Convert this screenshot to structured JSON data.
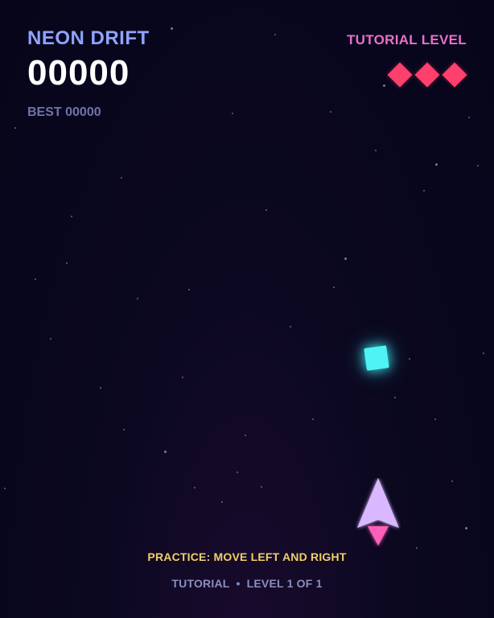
{
  "hud": {
    "title": "NEON DRIFT",
    "score": "00000",
    "best": "BEST 00000",
    "level": "TUTORIAL LEVEL",
    "lives": 3
  },
  "prompt": {
    "hint": "PRACTICE: MOVE LEFT AND RIGHT"
  },
  "footer": {
    "mode": "TUTORIAL",
    "separator": "•",
    "progress": "LEVEL 1 OF 1"
  },
  "colors": {
    "title": "#8fa3ff",
    "score": "#ffffff",
    "best": "#6e74a8",
    "level": "#ea6fc8",
    "life": "#ff3f6c",
    "gem": "#4ff2f5",
    "ship_body": "#d9b8ff",
    "ship_flame": "#ff5fb8",
    "hint": "#f2cf6a",
    "footer": "#8a8fbf"
  },
  "icons": {
    "life": "diamond-icon",
    "gem": "gem-icon",
    "player": "ship-icon"
  }
}
